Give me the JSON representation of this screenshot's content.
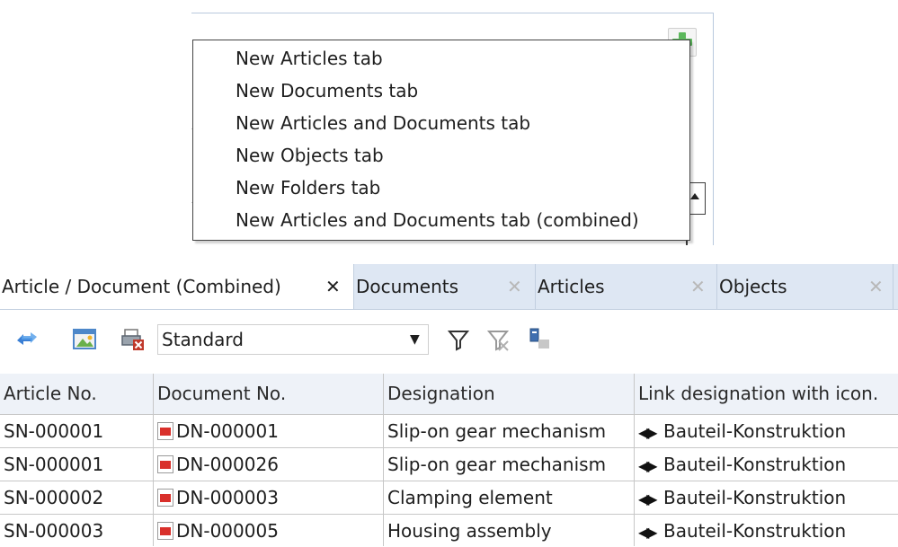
{
  "popup_menu": {
    "items": [
      "New Articles tab",
      "New Documents tab",
      "New Articles and Documents tab",
      "New Objects tab",
      "New Folders tab",
      "New Articles and Documents tab (combined)"
    ]
  },
  "tabs": [
    {
      "label": "Article / Document (Combined)",
      "close": "✕",
      "active": true
    },
    {
      "label": "Documents",
      "close": "✕",
      "active": false
    },
    {
      "label": "Articles",
      "close": "✕",
      "active": false
    },
    {
      "label": "Objects",
      "close": "✕",
      "active": false
    }
  ],
  "toolbar": {
    "view_select_value": "Standard",
    "icons": [
      "refresh-arrows-icon",
      "image-window-icon",
      "print-delete-icon",
      "filter-icon",
      "clear-filter-icon",
      "column-settings-icon"
    ]
  },
  "table": {
    "columns": [
      "Article No.",
      "Document No.",
      "Designation",
      "Link designation with icon."
    ],
    "rows": [
      {
        "article_no": "SN-000001",
        "document_no": "DN-000001",
        "designation": "Slip-on gear mechanism",
        "link": "Bauteil-Konstruktion"
      },
      {
        "article_no": "SN-000001",
        "document_no": "DN-000026",
        "designation": "Slip-on gear mechanism",
        "link": "Bauteil-Konstruktion"
      },
      {
        "article_no": "SN-000002",
        "document_no": "DN-000003",
        "designation": "Clamping element",
        "link": "Bauteil-Konstruktion"
      },
      {
        "article_no": "SN-000003",
        "document_no": "DN-000005",
        "designation": "Housing assembly",
        "link": "Bauteil-Konstruktion"
      }
    ]
  },
  "colors": {
    "tab_strip": "#dee7f3",
    "grid_line": "#c7c7c7",
    "pdf_red": "#d9302b",
    "add_green": "#5cb85c"
  }
}
